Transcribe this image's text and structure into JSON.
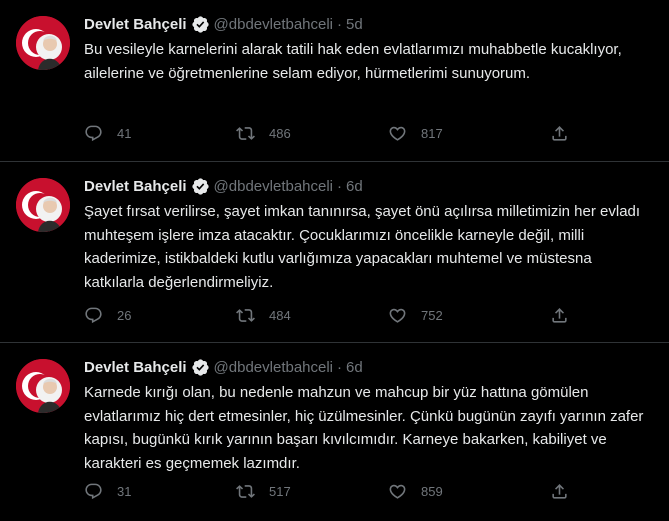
{
  "tweets": [
    {
      "name": "Devlet Bahçeli",
      "handle": "@dbdevletbahceli",
      "dot": "·",
      "time": "5d",
      "text": "Bu vesileyle karnelerini alarak tatili hak eden evlatlarımızı muhabbetle kucaklıyor, ailelerine ve öğretmenlerine selam ediyor, hürmetlerimi sunuyorum.",
      "replies": "41",
      "retweets": "486",
      "likes": "817"
    },
    {
      "name": "Devlet Bahçeli",
      "handle": "@dbdevletbahceli",
      "dot": "·",
      "time": "6d",
      "text": "Şayet fırsat verilirse, şayet imkan tanınırsa, şayet önü açılırsa milletimizin her evladı muhteşem işlere imza atacaktır. Çocuklarımızı öncelikle karneyle değil, milli kaderimize, istikbaldeki kutlu varlığımıza yapacakları muhtemel ve müstesna katkılarla değerlendirmeliyiz.",
      "replies": "26",
      "retweets": "484",
      "likes": "752"
    },
    {
      "name": "Devlet Bahçeli",
      "handle": "@dbdevletbahceli",
      "dot": "·",
      "time": "6d",
      "text": "Karnede kırığı olan, bu nedenle mahzun ve mahcup bir yüz hattına gömülen evlatlarımız hiç dert etmesinler, hiç üzülmesinler. Çünkü bugünün zayıfı yarının zafer kapısı, bugünkü kırık yarının başarı kıvılcımıdır. Karneye bakarken, kabiliyet ve karakteri es geçmemek lazımdır.",
      "replies": "31",
      "retweets": "517",
      "likes": "859"
    }
  ],
  "icons": {
    "reply": "reply-icon",
    "retweet": "retweet-icon",
    "like": "heart-icon",
    "share": "share-icon",
    "verified": "verified-badge-icon"
  },
  "colors": {
    "background": "#000000",
    "text": "#e7e9ea",
    "secondary": "#71767b",
    "divider": "#2f3336",
    "verified": "#1d9bf0",
    "avatar_red": "#c8102e"
  }
}
